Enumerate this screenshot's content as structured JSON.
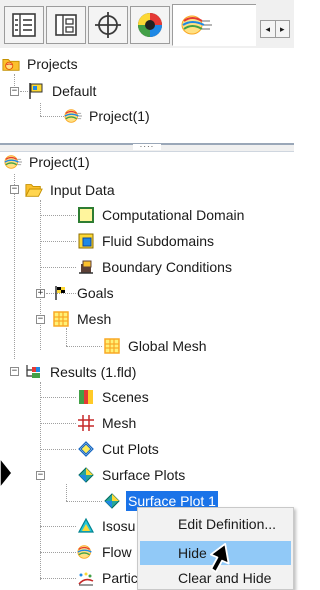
{
  "toolbar": {
    "tabs": [
      {
        "icon": "feature-tree-icon"
      },
      {
        "icon": "property-manager-icon"
      },
      {
        "icon": "configuration-manager-icon"
      },
      {
        "icon": "appearance-icon"
      },
      {
        "icon": "flow-simulation-icon",
        "active": true
      }
    ],
    "scroll_left": "◂",
    "scroll_right": "▸"
  },
  "projects_tree": {
    "root": "Projects",
    "default": "Default",
    "project": "Project(1)"
  },
  "analysis_tree": {
    "project": "Project(1)",
    "input_data": "Input Data",
    "computational_domain": "Computational Domain",
    "fluid_subdomains": "Fluid Subdomains",
    "boundary_conditions": "Boundary Conditions",
    "goals": "Goals",
    "mesh": "Mesh",
    "global_mesh": "Global Mesh",
    "results": "Results (1.fld)",
    "scenes": "Scenes",
    "results_mesh": "Mesh",
    "cut_plots": "Cut Plots",
    "surface_plots": "Surface Plots",
    "surface_plot_1": "Surface Plot 1",
    "isosurfaces": "Isosu",
    "flow_trajectories": "Flow",
    "particle_studies": "Partic"
  },
  "context_menu": {
    "edit_definition": "Edit Definition...",
    "hide": "Hide",
    "clear_and_hide": "Clear and Hide"
  },
  "colors": {
    "selection": "#1a73e8",
    "menu_highlight": "#91c9f7",
    "splitter": "#9aa7b8"
  }
}
